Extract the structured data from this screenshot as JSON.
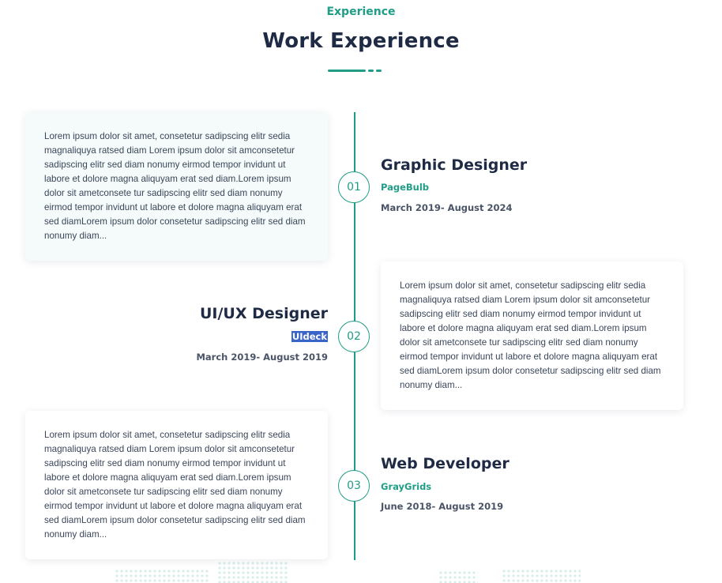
{
  "header": {
    "eyebrow": "Experience",
    "title": "Work Experience"
  },
  "colors": {
    "accent": "#1f9d86",
    "heading": "#1f2b44",
    "body": "#3a4659",
    "selection": "#3a65c8"
  },
  "timeline": [
    {
      "number": "01",
      "title": "Graphic Designer",
      "company": "PageBulb",
      "period": "March 2019- August 2024",
      "description": "Lorem ipsum dolor sit amet, consetetur sadipscing elitr sedia magnaliquya ratsed diam Lorem ipsum dolor sit amconsetetur sadipscing elitr sed diam nonumy eirmod tempor invidunt ut labore et dolore magna aliquyam erat sed diam.Lorem ipsum dolor sit ametconsete tur sadipscing elitr sed diam nonumy eirmod tempor invidunt ut labore et dolore magna aliquyam erat sed diamLorem ipsum dolor consetetur sadipscing elitr sed diam nonumy diam..."
    },
    {
      "number": "02",
      "title": "UI/UX Designer",
      "company": "UIdeck",
      "period": "March 2019- August 2019",
      "description": "Lorem ipsum dolor sit amet, consetetur sadipscing elitr sedia magnaliquya ratsed diam Lorem ipsum dolor sit amconsetetur sadipscing elitr sed diam nonumy eirmod tempor invidunt ut labore et dolore magna aliquyam erat sed diam.Lorem ipsum dolor sit ametconsete tur sadipscing elitr sed diam nonumy eirmod tempor invidunt ut labore et dolore magna aliquyam erat sed diamLorem ipsum dolor consetetur sadipscing elitr sed diam nonumy diam..."
    },
    {
      "number": "03",
      "title": "Web Developer",
      "company": "GrayGrids",
      "period": "June 2018- August 2019",
      "description": "Lorem ipsum dolor sit amet, consetetur sadipscing elitr sedia magnaliquya ratsed diam Lorem ipsum dolor sit amconsetetur sadipscing elitr sed diam nonumy eirmod tempor invidunt ut labore et dolore magna aliquyam erat sed diam.Lorem ipsum dolor sit ametconsete tur sadipscing elitr sed diam nonumy eirmod tempor invidunt ut labore et dolore magna aliquyam erat sed diamLorem ipsum dolor consetetur sadipscing elitr sed diam nonumy diam..."
    }
  ]
}
